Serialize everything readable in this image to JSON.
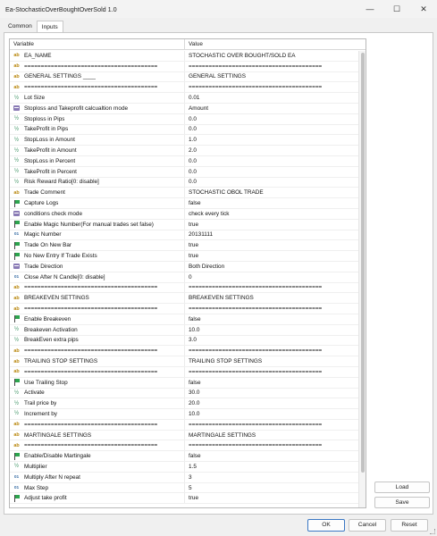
{
  "window": {
    "title": "Ea-StochasticOverBoughtOverSold 1.0",
    "minimize": "—",
    "maximize": "☐",
    "close": "✕"
  },
  "tabs": [
    "Common",
    "Inputs"
  ],
  "grid": {
    "col_variable": "Variable",
    "col_value": "Value",
    "rows": [
      {
        "icon": "ab",
        "variable": "EA_NAME",
        "value": "STOCHASTIC OVER BOUGHT/SOLD EA"
      },
      {
        "icon": "ab",
        "variable": "========================================",
        "value": "========================================"
      },
      {
        "icon": "ab",
        "variable": "GENERAL SETTINGS ____",
        "value": "GENERAL SETTINGS"
      },
      {
        "icon": "ab",
        "variable": "========================================",
        "value": "========================================"
      },
      {
        "icon": "dbl",
        "variable": "Lot Size",
        "value": "0.01"
      },
      {
        "icon": "enm",
        "variable": "Stoploss and Takeprofit calcualtion mode",
        "value": "Amount"
      },
      {
        "icon": "dbl",
        "variable": "Stoploss in Pips",
        "value": "0.0"
      },
      {
        "icon": "dbl",
        "variable": "TakeProfit in Pips",
        "value": "0.0"
      },
      {
        "icon": "dbl",
        "variable": "StopLoss in Amount",
        "value": "1.0"
      },
      {
        "icon": "dbl",
        "variable": "TakeProfit in Amount",
        "value": "2.0"
      },
      {
        "icon": "dbl",
        "variable": "StopLoss in Percent",
        "value": "0.0"
      },
      {
        "icon": "dbl",
        "variable": "TakeProfit in Percent",
        "value": "0.0"
      },
      {
        "icon": "dbl",
        "variable": "Risk Reward Ratio[0: disable]",
        "value": "0.0"
      },
      {
        "icon": "ab",
        "variable": "Trade Comment",
        "value": "STOCHASTIC OBOL TRADE"
      },
      {
        "icon": "flag",
        "variable": "Capture Logs",
        "value": "false"
      },
      {
        "icon": "enm",
        "variable": "conditions check mode",
        "value": "check every tick"
      },
      {
        "icon": "flag",
        "variable": "Enable Magic Number(For manual trades set false)",
        "value": "true"
      },
      {
        "icon": "num",
        "variable": "Magic Number",
        "value": "20131111"
      },
      {
        "icon": "flag",
        "variable": "Trade On New Bar",
        "value": "true"
      },
      {
        "icon": "flag",
        "variable": "No New Entry If Trade Exists",
        "value": "true"
      },
      {
        "icon": "enm",
        "variable": "Trade Direction",
        "value": "Both Direction"
      },
      {
        "icon": "num",
        "variable": "Close After N Candle[0: disable]",
        "value": "0"
      },
      {
        "icon": "ab",
        "variable": "========================================",
        "value": "========================================"
      },
      {
        "icon": "ab",
        "variable": "BREAKEVEN SETTINGS",
        "value": "BREAKEVEN SETTINGS"
      },
      {
        "icon": "ab",
        "variable": "========================================",
        "value": "========================================"
      },
      {
        "icon": "flag",
        "variable": "Enable Breakeven",
        "value": "false"
      },
      {
        "icon": "dbl",
        "variable": "Breakeven Activation",
        "value": "10.0"
      },
      {
        "icon": "dbl",
        "variable": "BreakEven extra pips",
        "value": "3.0"
      },
      {
        "icon": "ab",
        "variable": "========================================",
        "value": "========================================"
      },
      {
        "icon": "ab",
        "variable": "TRAILING STOP SETTINGS",
        "value": "TRAILING STOP SETTINGS"
      },
      {
        "icon": "ab",
        "variable": "========================================",
        "value": "========================================"
      },
      {
        "icon": "flag",
        "variable": "Use Trailing Stop",
        "value": "false"
      },
      {
        "icon": "dbl",
        "variable": "Activate",
        "value": "30.0"
      },
      {
        "icon": "dbl",
        "variable": "Trail price by",
        "value": "20.0"
      },
      {
        "icon": "dbl",
        "variable": "Increment by",
        "value": "10.0"
      },
      {
        "icon": "ab",
        "variable": "========================================",
        "value": "========================================"
      },
      {
        "icon": "ab",
        "variable": "MARTINGALE SETTINGS",
        "value": "MARTINGALE SETTINGS"
      },
      {
        "icon": "ab",
        "variable": "========================================",
        "value": "========================================"
      },
      {
        "icon": "flag",
        "variable": "Enable/Disable Martingale",
        "value": "false"
      },
      {
        "icon": "dbl",
        "variable": "Multiplier",
        "value": "1.5"
      },
      {
        "icon": "num",
        "variable": "Multiply After N repeat",
        "value": "3"
      },
      {
        "icon": "num",
        "variable": "Max Step",
        "value": "5"
      },
      {
        "icon": "flag",
        "variable": "Adjust take profit",
        "value": "true"
      }
    ]
  },
  "icon_glyphs": {
    "ab": "ab",
    "num": "01",
    "dbl": "½",
    "flag": "",
    "enm": ""
  },
  "side_buttons": {
    "load": "Load",
    "save": "Save"
  },
  "footer": {
    "ok": "OK",
    "cancel": "Cancel",
    "reset": "Reset"
  },
  "colors": {
    "ok_border": "#3b78c4",
    "flag": "#2da44e"
  }
}
